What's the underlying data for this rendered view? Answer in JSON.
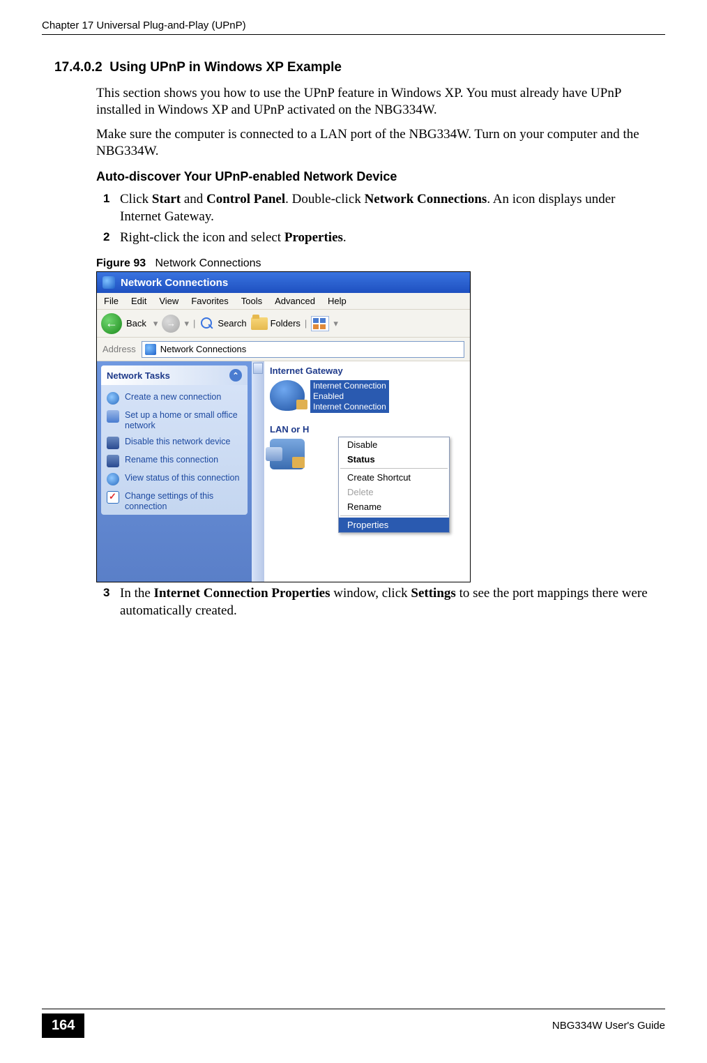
{
  "header": {
    "running_head": "Chapter 17 Universal Plug-and-Play (UPnP)"
  },
  "section": {
    "number": "17.4.0.2",
    "title": "Using UPnP in Windows XP Example"
  },
  "para1": "This section shows you how to use the UPnP feature in Windows XP. You must already have UPnP installed in Windows XP and UPnP activated on the NBG334W.",
  "para2": "Make sure the computer is connected to a LAN port of the NBG334W. Turn on your computer and the NBG334W.",
  "subheading": "Auto-discover Your UPnP-enabled Network Device",
  "steps": {
    "s1": {
      "num": "1",
      "pre": "Click ",
      "b1": "Start",
      "mid1": " and ",
      "b2": "Control Panel",
      "mid2": ". Double-click ",
      "b3": "Network Connections",
      "post": ". An icon displays under Internet Gateway."
    },
    "s2": {
      "num": "2",
      "pre": "Right-click the icon and select ",
      "b1": "Properties",
      "post": "."
    },
    "s3": {
      "num": "3",
      "pre": "In the ",
      "b1": "Internet Connection Properties",
      "mid1": " window, click ",
      "b2": "Settings",
      "post": " to see the port mappings there were automatically created."
    }
  },
  "figure": {
    "label": "Figure 93",
    "title": "Network Connections"
  },
  "screenshot": {
    "title": "Network Connections",
    "menus": {
      "file": "File",
      "edit": "Edit",
      "view": "View",
      "favorites": "Favorites",
      "tools": "Tools",
      "advanced": "Advanced",
      "help": "Help"
    },
    "toolbar": {
      "back": "Back",
      "search": "Search",
      "folders": "Folders"
    },
    "address_label": "Address",
    "address_value": "Network Connections",
    "side_panel": {
      "title": "Network Tasks",
      "items": {
        "create": "Create a new connection",
        "setup": "Set up a home or small office network",
        "disable": "Disable this network device",
        "rename": "Rename this connection",
        "status": "View status of this connection",
        "settings": "Change settings of this connection"
      }
    },
    "main": {
      "group1": "Internet Gateway",
      "conn1_line1": "Internet Connection",
      "conn1_line2": "Enabled",
      "conn1_line3": "Internet Connection",
      "group2": "LAN or H",
      "context": {
        "disable": "Disable",
        "status": "Status",
        "create_shortcut": "Create Shortcut",
        "delete": "Delete",
        "rename": "Rename",
        "properties": "Properties"
      }
    }
  },
  "footer": {
    "page": "164",
    "guide": "NBG334W User's Guide"
  }
}
